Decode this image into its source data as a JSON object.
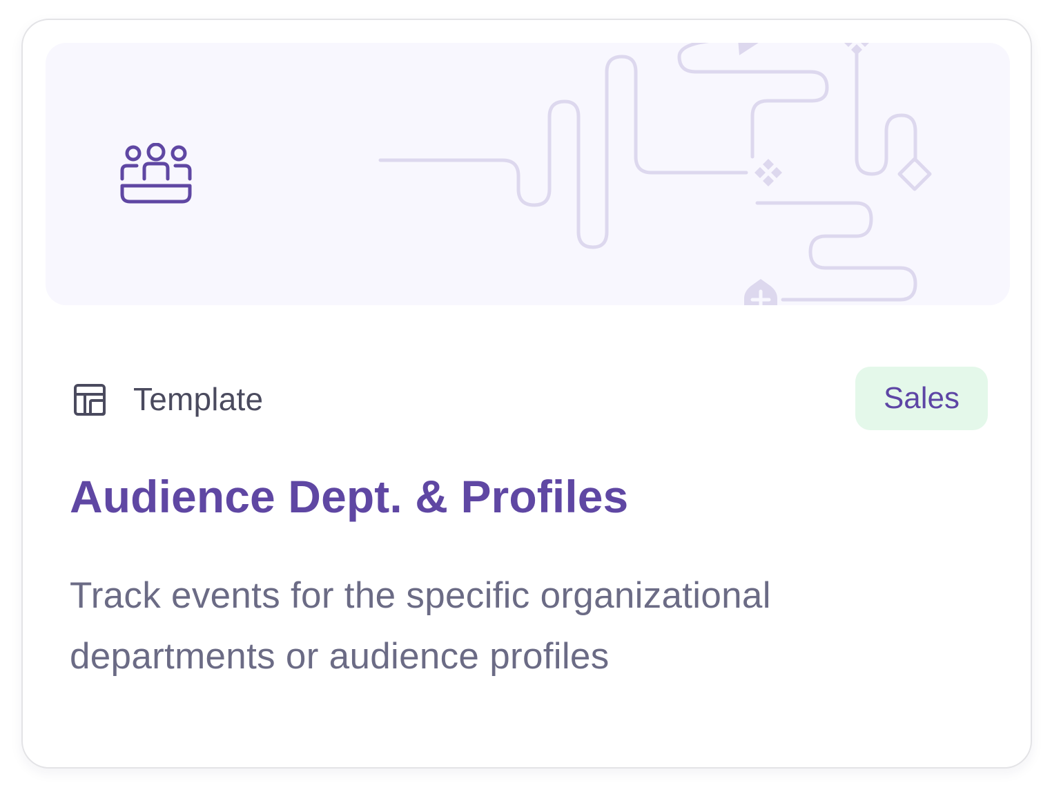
{
  "card": {
    "type_label": "Template",
    "tag": "Sales",
    "title": "Audience Dept. & Profiles",
    "description": "Track events for the specific organizational departments or audience profiles"
  },
  "icons": {
    "hero": "audience-group-icon",
    "type": "template-layout-icon"
  },
  "colors": {
    "accent": "#5f47a3",
    "tag_bg": "#e4f8ea",
    "hero_bg": "#f8f7fe",
    "decor_line": "#ddd8ee"
  }
}
